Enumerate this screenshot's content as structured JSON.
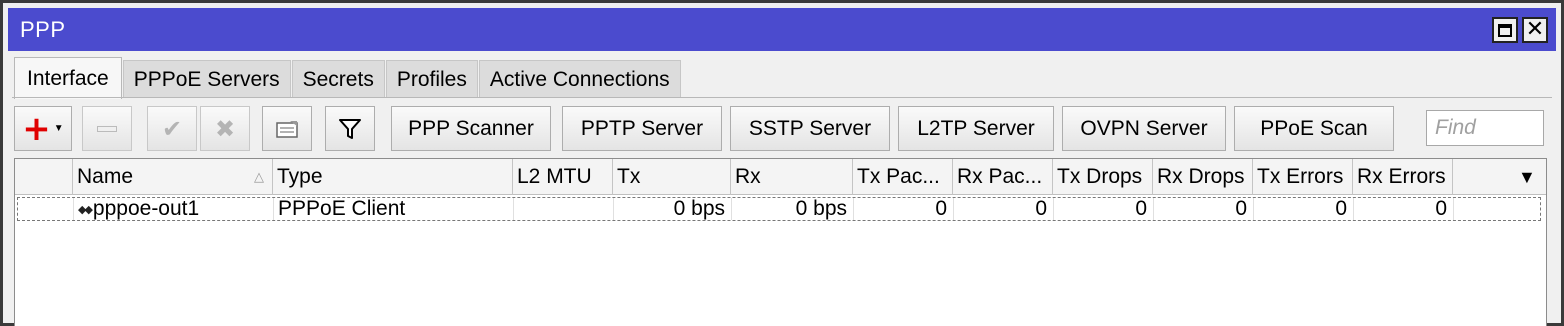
{
  "window": {
    "title": "PPP",
    "maximize_icon": "maximize-icon",
    "close_icon": "close-icon",
    "close_glyph": "✕"
  },
  "tabs": [
    {
      "label": "Interface",
      "active": true
    },
    {
      "label": "PPPoE Servers",
      "active": false
    },
    {
      "label": "Secrets",
      "active": false
    },
    {
      "label": "Profiles",
      "active": false
    },
    {
      "label": "Active Connections",
      "active": false
    }
  ],
  "toolbar": {
    "add_icon": "plus-icon",
    "add_glyph": "+",
    "add_caret": "▼",
    "remove_icon": "minus-icon",
    "enable_icon": "check-icon",
    "enable_glyph": "✔",
    "disable_icon": "x-icon",
    "disable_glyph": "✖",
    "comment_icon": "comment-icon",
    "filter_icon": "filter-icon",
    "buttons": [
      "PPP Scanner",
      "PPTP Server",
      "SSTP Server",
      "L2TP Server",
      "OVPN Server",
      "PPoE Scan"
    ],
    "find_placeholder": "Find"
  },
  "table": {
    "columns": [
      "Name",
      "Type",
      "L2 MTU",
      "Tx",
      "Rx",
      "Tx Pac...",
      "Rx Pac...",
      "Tx Drops",
      "Rx Drops",
      "Tx Errors",
      "Rx Errors"
    ],
    "sort_marker": "△",
    "menu_caret": "▼",
    "rows": [
      {
        "icon": "interface-icon",
        "icon_glyph": "◆◆",
        "name": "pppoe-out1",
        "type": "PPPoE Client",
        "l2mtu": "",
        "tx": "0 bps",
        "rx": "0 bps",
        "tx_packets": "0",
        "rx_packets": "0",
        "tx_drops": "0",
        "rx_drops": "0",
        "tx_errors": "0",
        "rx_errors": "0"
      }
    ]
  }
}
